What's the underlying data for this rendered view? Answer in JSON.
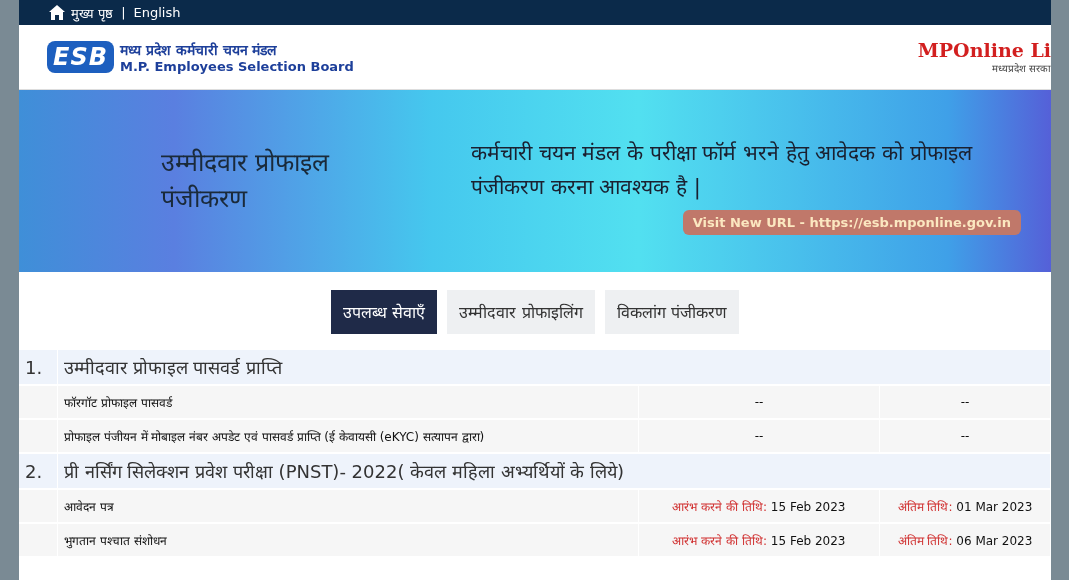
{
  "topbar": {
    "home": "मुख्य पृष्ठ",
    "separator": "|",
    "language": "English"
  },
  "header": {
    "logo_mark": "ESB",
    "org_hindi": "मध्य प्रदेश कर्मचारी चयन मंडल",
    "org_english": "M.P. Employees Selection Board",
    "partner_logo": "MPOnline Li",
    "partner_sub": "मध्यप्रदेश सरका"
  },
  "banner": {
    "title": "उम्मीदवार प्रोफाइल पंजीकरण",
    "message": "कर्मचारी चयन मंडल के परीक्षा फॉर्म भरने हेतु आवेदक को प्रोफाइल पंजीकरण करना आवश्यक है |",
    "url_notice": "Visit New URL - https://esb.mponline.gov.in"
  },
  "tabs": [
    {
      "label": "उपलब्ध सेवाएँ",
      "selected": true
    },
    {
      "label": "उम्मीदवार प्रोफाइलिंग",
      "selected": false
    },
    {
      "label": "विकलांग पंजीकरण",
      "selected": false
    }
  ],
  "sections": [
    {
      "number": "1.",
      "title": "उम्मीदवार प्रोफाइल पासवर्ड प्राप्ति",
      "rows": [
        {
          "name": "फॉरगॉट प्रोफाइल पासवर्ड",
          "start": {
            "value": "--"
          },
          "end": {
            "value": "--"
          }
        },
        {
          "name": "प्रोफाइल पंजीयन में मोबाइल नंबर अपडेट एवं पासवर्ड प्राप्ति (ई केवायसी (eKYC) सत्यापन द्वारा)",
          "start": {
            "value": "--"
          },
          "end": {
            "value": "--"
          }
        }
      ]
    },
    {
      "number": "2.",
      "title": "प्री नर्सिंग सिलेक्शन प्रवेश परीक्षा (PNST)- 2022( केवल महिला अभ्यर्थियों के लिये)",
      "rows": [
        {
          "name": "आवेदन पत्र",
          "start": {
            "label": "आरंभ करने की तिथि:",
            "value": "15 Feb 2023"
          },
          "end": {
            "label": "अंतिम तिथि:",
            "value": "01 Mar 2023"
          }
        },
        {
          "name": "भुगतान पश्चात संशोधन",
          "start": {
            "label": "आरंभ करने की तिथि:",
            "value": "15 Feb 2023"
          },
          "end": {
            "label": "अंतिम तिथि:",
            "value": "06 Mar 2023"
          }
        }
      ]
    }
  ]
}
